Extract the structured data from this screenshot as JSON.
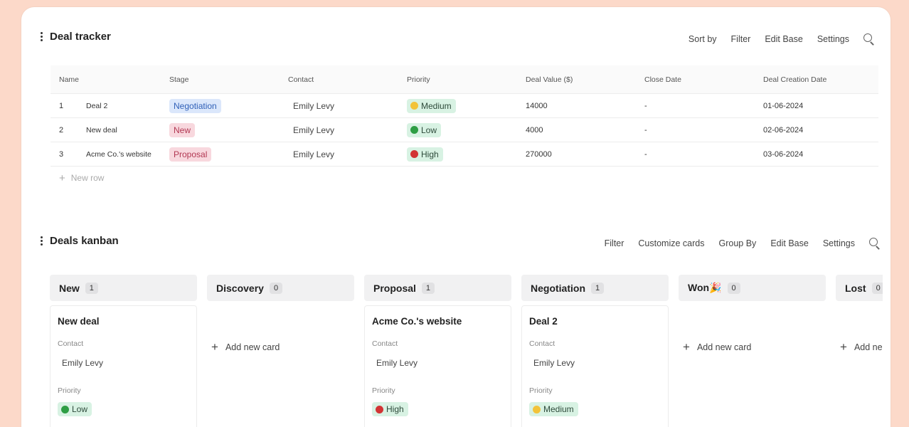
{
  "tracker": {
    "title": "Deal tracker",
    "actions": [
      "Sort by",
      "Filter",
      "Edit Base",
      "Settings"
    ],
    "columns": [
      "Name",
      "Stage",
      "Contact",
      "Priority",
      "Deal Value ($)",
      "Close Date",
      "Deal Creation Date"
    ],
    "rows": [
      {
        "num": "1",
        "name": "Deal 2",
        "stage": "Negotiation",
        "contact": "Emily Levy",
        "priority": "Medium",
        "value": "14000",
        "close": "-",
        "created": "01-06-2024"
      },
      {
        "num": "2",
        "name": "New deal",
        "stage": "New",
        "contact": "Emily Levy",
        "priority": "Low",
        "value": "4000",
        "close": "-",
        "created": "02-06-2024"
      },
      {
        "num": "3",
        "name": "Acme Co.'s website",
        "stage": "Proposal",
        "contact": "Emily Levy",
        "priority": "High",
        "value": "270000",
        "close": "-",
        "created": "03-06-2024"
      }
    ],
    "new_row": "New row"
  },
  "kanban": {
    "title": "Deals kanban",
    "actions": [
      "Filter",
      "Customize cards",
      "Group By",
      "Edit Base",
      "Settings"
    ],
    "add_card": "Add new card",
    "add_card_truncated": "Add ne",
    "contact_label": "Contact",
    "priority_label": "Priority",
    "columns": [
      {
        "title": "New",
        "count": "1",
        "card": {
          "title": "New deal",
          "contact": "Emily Levy",
          "priority": "Low"
        }
      },
      {
        "title": "Discovery",
        "count": "0"
      },
      {
        "title": "Proposal",
        "count": "1",
        "card": {
          "title": "Acme Co.'s website",
          "contact": "Emily Levy",
          "priority": "High"
        }
      },
      {
        "title": "Negotiation",
        "count": "1",
        "card": {
          "title": "Deal 2",
          "contact": "Emily Levy",
          "priority": "Medium"
        }
      },
      {
        "title": "Won🎉",
        "count": "0"
      },
      {
        "title": "Lost",
        "count": "0"
      }
    ]
  },
  "colors": {
    "background": "#fcd9c9",
    "priority_low": "#2e9e44",
    "priority_medium": "#f2c33a",
    "priority_high": "#d23434"
  }
}
